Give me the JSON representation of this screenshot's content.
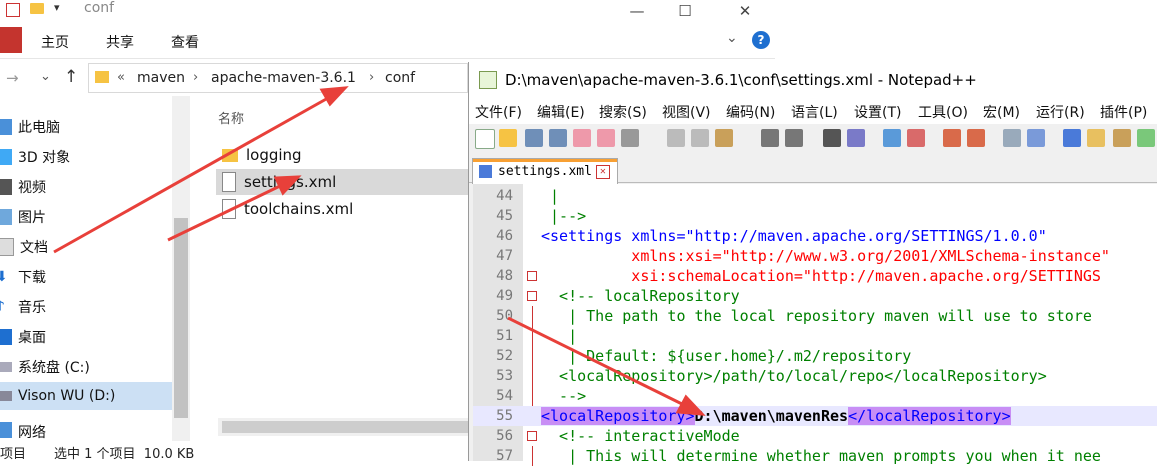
{
  "explorer": {
    "title": "conf",
    "ribbon_tabs": [
      "主页",
      "共享",
      "查看"
    ],
    "breadcrumb": [
      "«",
      "maven",
      "apache-maven-3.6.1",
      "conf"
    ],
    "nav_items": [
      {
        "label": "此电脑",
        "icon": "computer-icon"
      },
      {
        "label": "3D 对象",
        "icon": "cube-icon"
      },
      {
        "label": "视频",
        "icon": "video-icon"
      },
      {
        "label": "图片",
        "icon": "picture-icon"
      },
      {
        "label": "文档",
        "icon": "document-icon"
      },
      {
        "label": "下载",
        "icon": "download-icon"
      },
      {
        "label": "音乐",
        "icon": "music-icon"
      },
      {
        "label": "桌面",
        "icon": "desktop-icon"
      },
      {
        "label": "系统盘 (C:)",
        "icon": "drive-icon"
      },
      {
        "label": "Vison WU (D:)",
        "icon": "drive-icon"
      },
      {
        "label": "网络",
        "icon": "network-icon"
      }
    ],
    "column_header": "名称",
    "files": [
      {
        "name": "logging",
        "type": "folder"
      },
      {
        "name": "settings.xml",
        "type": "file"
      },
      {
        "name": "toolchains.xml",
        "type": "file"
      }
    ],
    "status": {
      "left": "项目",
      "selection": "选中 1 个项目  10.0 KB"
    }
  },
  "npp": {
    "title": "D:\\maven\\apache-maven-3.6.1\\conf\\settings.xml - Notepad++",
    "menu": [
      "文件(F)",
      "编辑(E)",
      "搜索(S)",
      "视图(V)",
      "编码(N)",
      "语言(L)",
      "设置(T)",
      "工具(O)",
      "宏(M)",
      "运行(R)",
      "插件(P)"
    ],
    "tab_label": "settings.xml",
    "lines": [
      {
        "n": "44",
        "code": " |"
      },
      {
        "n": "45",
        "code": " |-->"
      },
      {
        "n": "46",
        "code": "<settings xmlns=\"http://maven.apache.org/SETTINGS/1.0.0\""
      },
      {
        "n": "47",
        "code": "          xmlns:xsi=\"http://www.w3.org/2001/XMLSchema-instance\""
      },
      {
        "n": "48",
        "code": "          xsi:schemaLocation=\"http://maven.apache.org/SETTINGS"
      },
      {
        "n": "49",
        "code": "  <!-- localRepository"
      },
      {
        "n": "50",
        "code": "   | The path to the local repository maven will use to store"
      },
      {
        "n": "51",
        "code": "   |"
      },
      {
        "n": "52",
        "code": "   | Default: ${user.home}/.m2/repository"
      },
      {
        "n": "53",
        "code": "  <localRepository>/path/to/local/repo</localRepository>"
      },
      {
        "n": "54",
        "code": "  -->"
      },
      {
        "n": "55",
        "code": "<localRepository>D:\\maven\\mavenRes</localRepository>"
      },
      {
        "n": "56",
        "code": "  <!-- interactiveMode"
      },
      {
        "n": "57",
        "code": "   | This will determine whether maven prompts you when it nee"
      }
    ]
  }
}
